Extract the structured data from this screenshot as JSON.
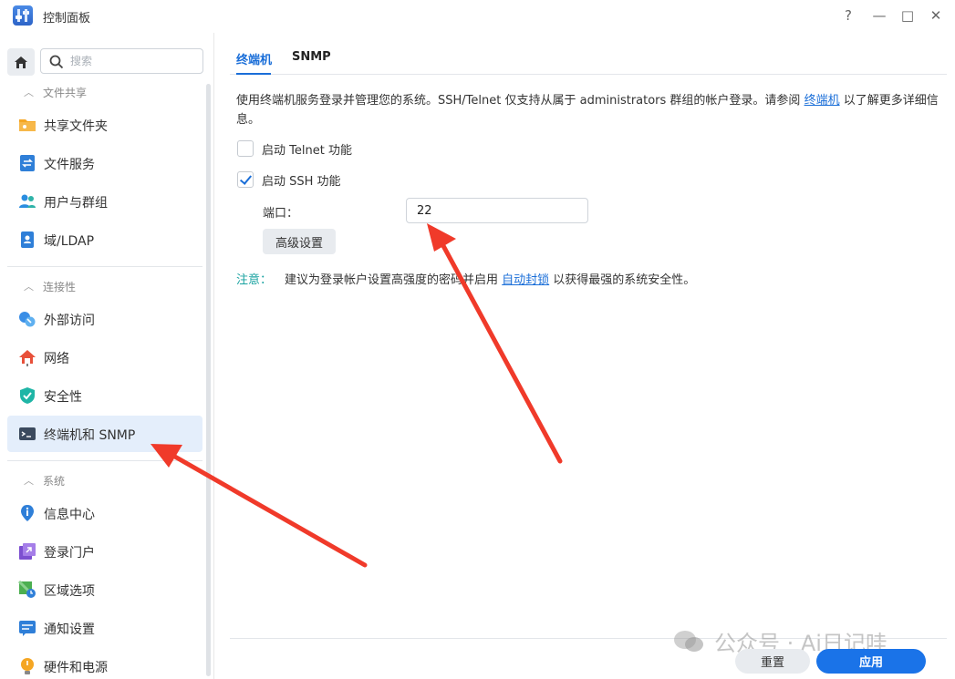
{
  "window": {
    "title": "控制面板",
    "controls": [
      "?",
      "—",
      "□",
      "✕"
    ]
  },
  "sidebar": {
    "search_placeholder": "搜索",
    "sections": [
      {
        "title": "文件共享",
        "items": [
          {
            "label": "共享文件夹",
            "icon": "shared-folder-icon"
          },
          {
            "label": "文件服务",
            "icon": "file-services-icon"
          },
          {
            "label": "用户与群组",
            "icon": "users-groups-icon"
          },
          {
            "label": "域/LDAP",
            "icon": "domain-ldap-icon"
          }
        ]
      },
      {
        "title": "连接性",
        "items": [
          {
            "label": "外部访问",
            "icon": "external-access-icon"
          },
          {
            "label": "网络",
            "icon": "network-icon"
          },
          {
            "label": "安全性",
            "icon": "security-shield-icon"
          },
          {
            "label": "终端机和 SNMP",
            "icon": "terminal-icon",
            "active": true
          }
        ]
      },
      {
        "title": "系统",
        "items": [
          {
            "label": "信息中心",
            "icon": "info-center-icon"
          },
          {
            "label": "登录门户",
            "icon": "login-portal-icon"
          },
          {
            "label": "区域选项",
            "icon": "regional-options-icon"
          },
          {
            "label": "通知设置",
            "icon": "notification-icon"
          },
          {
            "label": "硬件和电源",
            "icon": "hardware-power-icon"
          }
        ]
      }
    ]
  },
  "main": {
    "tabs": [
      {
        "label": "终端机",
        "active": true
      },
      {
        "label": "SNMP",
        "active": false
      }
    ],
    "description": {
      "text_before": "使用终端机服务登录并管理您的系统。SSH/Telnet 仅支持从属于 administrators 群组的帐户登录。请参阅 ",
      "link": "终端机",
      "text_after": " 以了解更多详细信息。"
    },
    "telnet": {
      "label": "启动 Telnet 功能",
      "checked": false
    },
    "ssh": {
      "label": "启动 SSH 功能",
      "checked": true
    },
    "port": {
      "label": "端口：",
      "value": "22"
    },
    "advanced_button": "高级设置",
    "note": {
      "tag": "注意：",
      "text_before": "建议为登录帐户设置高强度的密码并启用 ",
      "link": "自动封锁",
      "text_after": " 以获得最强的系统安全性。"
    },
    "footer": {
      "reset": "重置",
      "apply": "应用"
    }
  },
  "watermark": "公众号 · Ai日记哇",
  "colors": {
    "accent": "#1a6ed8",
    "active_bg": "#e4eefb",
    "note_tag": "#18a2a0",
    "arrow": "#f03a2a"
  }
}
